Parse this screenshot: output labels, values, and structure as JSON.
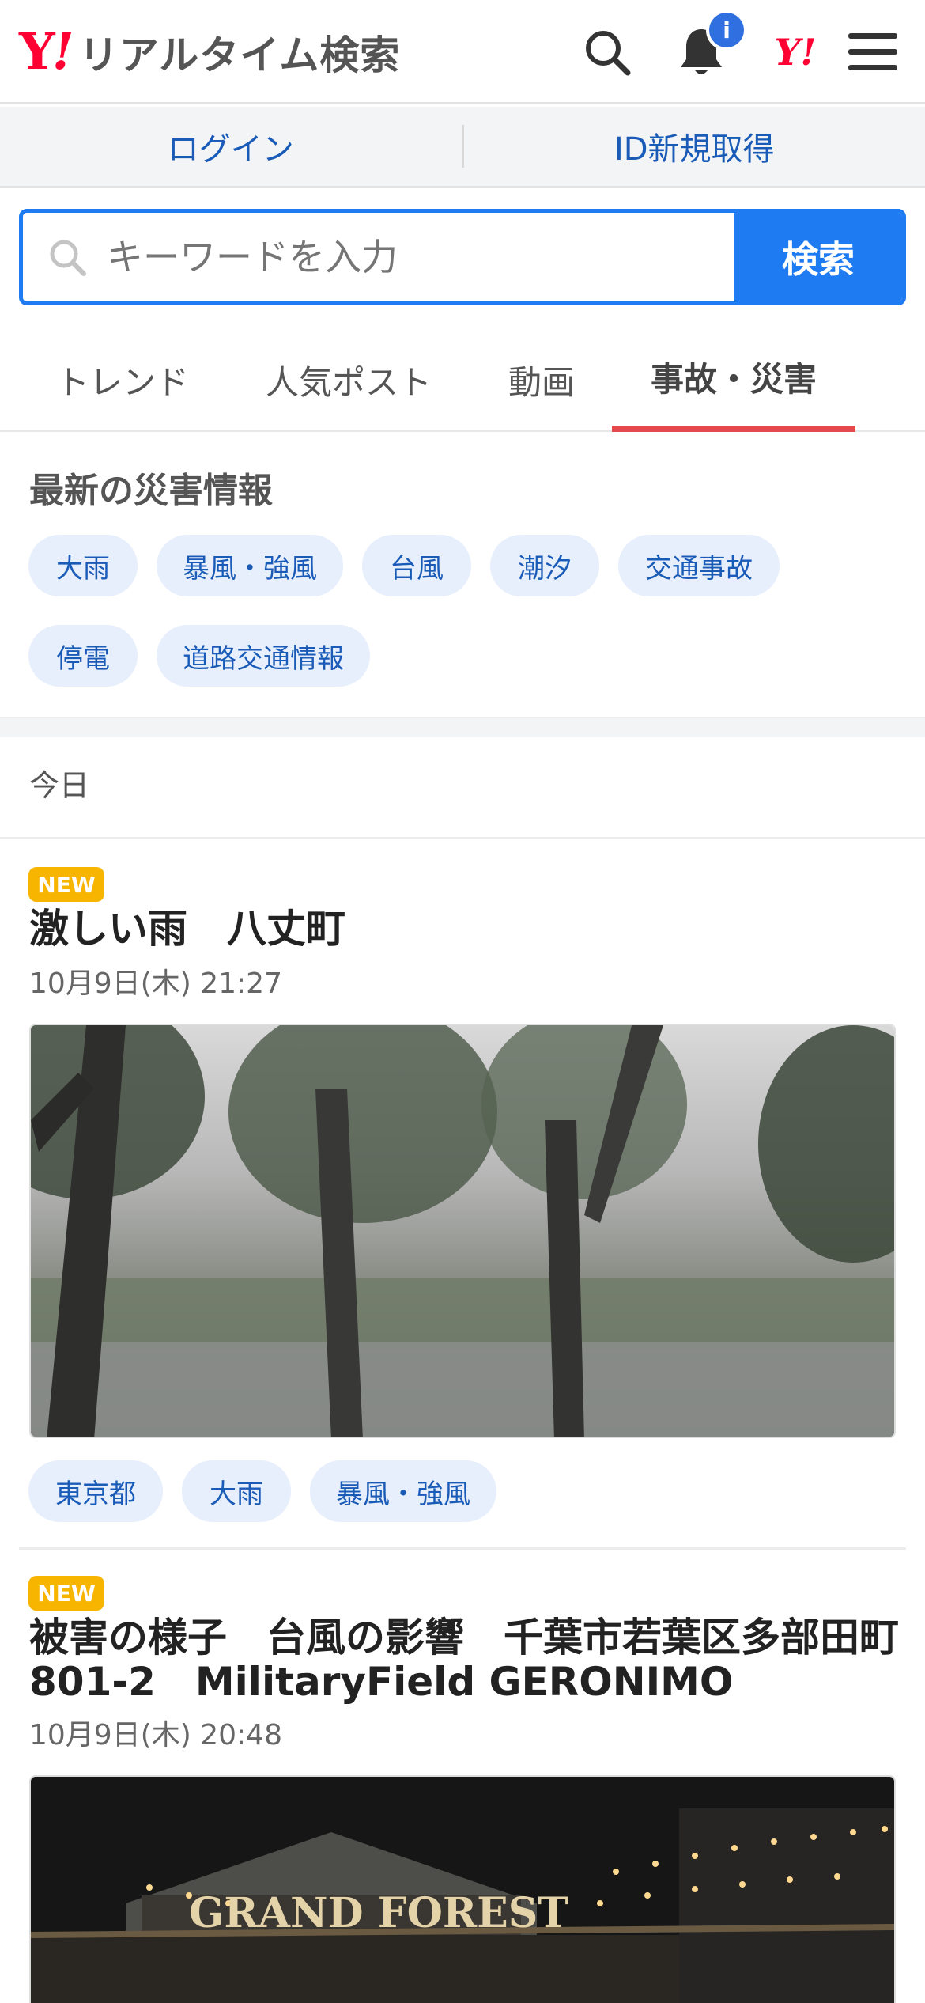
{
  "header": {
    "logo_mark": "Y",
    "logo_excl": "!",
    "logo_text": "リアルタイム検索",
    "notification_badge": "i",
    "yahoo_mark": "Y!"
  },
  "auth": {
    "login": "ログイン",
    "signup": "ID新規取得"
  },
  "search": {
    "placeholder": "キーワードを入力",
    "button": "検索"
  },
  "tabs": [
    {
      "label": "トレンド",
      "active": false
    },
    {
      "label": "人気ポスト",
      "active": false
    },
    {
      "label": "動画",
      "active": false
    },
    {
      "label": "事故・災害",
      "active": true
    }
  ],
  "disaster": {
    "title": "最新の災害情報",
    "chips": [
      "大雨",
      "暴風・強風",
      "台風",
      "潮汐",
      "交通事故",
      "停電",
      "道路交通情報"
    ]
  },
  "feed": {
    "date_header": "今日",
    "posts": [
      {
        "badge": "NEW",
        "title": "激しい雨　八丈町",
        "time": "10月9日(木) 21:27",
        "tags": [
          "東京都",
          "大雨",
          "暴風・強風"
        ]
      },
      {
        "badge": "NEW",
        "title_line1": "被害の様子　台風の影響　千葉市若葉区多部田町",
        "title_line2": "801-2　MilitaryField GERONIMO",
        "time": "10月9日(木) 20:48",
        "image_sign": "GRAND FOREST"
      }
    ]
  },
  "colors": {
    "accent": "#1f7bf2",
    "tab_underline": "#e5484d",
    "new_badge": "#f7b500",
    "chip_bg": "#e6effb",
    "link": "#1a5bb8",
    "brand": "#ff0033"
  }
}
